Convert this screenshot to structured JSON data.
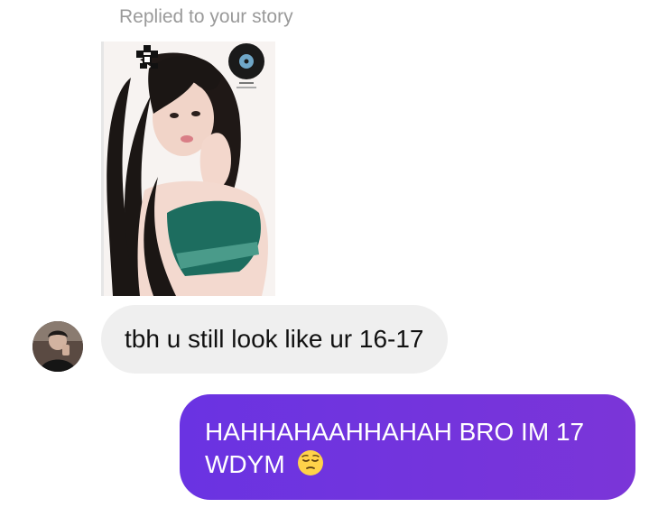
{
  "thread": {
    "replied_label": "Replied to your story",
    "incoming_message": "tbh u still look like ur 16-17",
    "outgoing_line1": "HAHHAHAAHHAHAH BRO IM 17",
    "outgoing_line2": "WDYM",
    "outgoing_emoji": "pensive-face"
  },
  "colors": {
    "incoming_bubble": "#efefef",
    "outgoing_bubble": "#6a33e2",
    "meta_text": "#9a9a9a"
  }
}
